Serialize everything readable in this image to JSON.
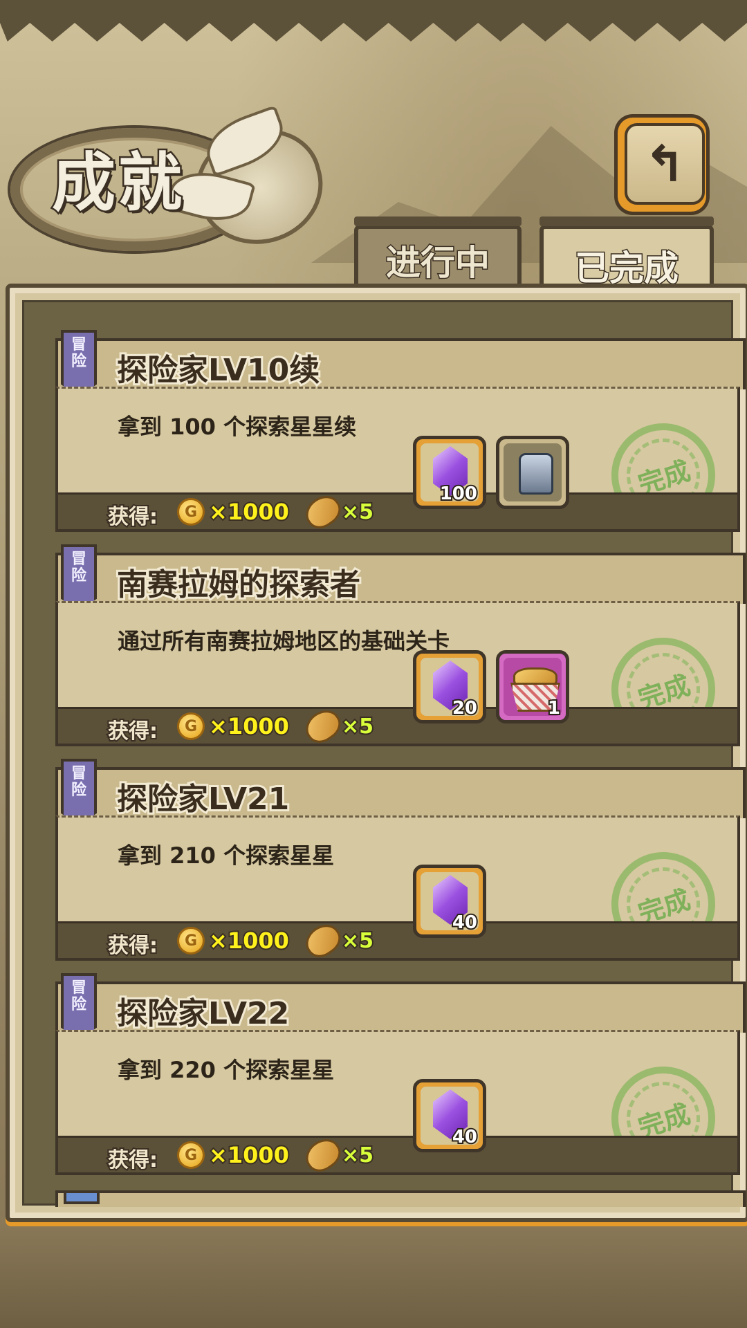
{
  "header": {
    "title": "成就",
    "back_icon": "back-arrow-icon"
  },
  "tabs": [
    {
      "label": "进行中",
      "active": false
    },
    {
      "label": "已完成",
      "active": true
    }
  ],
  "achievements": [
    {
      "category": "冒险",
      "title": "探险家LV10续",
      "description": "拿到 100 个探索星星续",
      "reward_label": "获得:",
      "coin_amount": "×1000",
      "bread_amount": "×5",
      "stamp": "完成",
      "items": [
        {
          "icon": "purple-gem-icon",
          "count": "100"
        },
        {
          "icon": "helmet-icon",
          "count": ""
        }
      ]
    },
    {
      "category": "冒险",
      "title": "南赛拉姆的探索者",
      "description": "通过所有南赛拉姆地区的基础关卡",
      "reward_label": "获得:",
      "coin_amount": "×1000",
      "bread_amount": "×5",
      "stamp": "完成",
      "items": [
        {
          "icon": "purple-gem-icon",
          "count": "20"
        },
        {
          "icon": "bread-basket-icon",
          "count": "1"
        }
      ]
    },
    {
      "category": "冒险",
      "title": "探险家LV21",
      "description": "拿到 210 个探索星星",
      "reward_label": "获得:",
      "coin_amount": "×1000",
      "bread_amount": "×5",
      "stamp": "完成",
      "items": [
        {
          "icon": "purple-gem-icon",
          "count": "40"
        }
      ]
    },
    {
      "category": "冒险",
      "title": "探险家LV22",
      "description": "拿到 220 个探索星星",
      "reward_label": "获得:",
      "coin_amount": "×1000",
      "bread_amount": "×5",
      "stamp": "完成",
      "items": [
        {
          "icon": "purple-gem-icon",
          "count": "40"
        }
      ]
    }
  ],
  "coin_symbol": "G",
  "colors": {
    "accent": "#e59a2a",
    "stamp_green": "#5aa53c",
    "coin_yellow": "#fff21c",
    "bread_green": "#d8ff3a",
    "badge_purple": "#7a6fae"
  }
}
